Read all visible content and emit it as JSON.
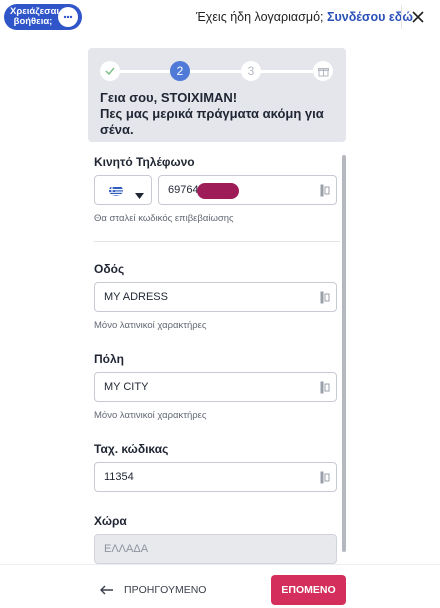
{
  "header": {
    "help_label": "Χρειάζεσαι βοήθεια;",
    "have_account_text": "Έχεις ήδη λογαριασμό;",
    "login_link": "Συνδέσου εδώ",
    "help_icon": "chat-bubble-icon",
    "close_icon": "close-icon"
  },
  "stepper": {
    "steps": [
      {
        "label": "",
        "icon": "check-icon",
        "state": "completed"
      },
      {
        "label": "2",
        "state": "active"
      },
      {
        "label": "3",
        "state": "upcoming"
      },
      {
        "label": "",
        "icon": "gift-icon",
        "state": "upcoming"
      }
    ],
    "greeting_line1": "Γεια σου, STOIXIMAN!",
    "greeting_line2": "Πες μας μερικά πράγματα ακόμη για σένα."
  },
  "form": {
    "phone": {
      "label": "Κινητό Τηλέφωνο",
      "country_flag": "greece-flag-icon",
      "value": "69764",
      "hint": "Θα σταλεί κωδικός επιβεβαίωσης"
    },
    "street": {
      "label": "Οδός",
      "value": "MY ADRESS",
      "hint": "Μόνο λατινικοί χαρακτήρες"
    },
    "city": {
      "label": "Πόλη",
      "value": "MY CITY",
      "hint": "Μόνο λατινικοί χαρακτήρες"
    },
    "postal": {
      "label": "Ταχ. κώδικας",
      "value": "11354"
    },
    "country": {
      "label": "Χώρα",
      "value": "ΕΛΛΑΔΑ"
    }
  },
  "footer": {
    "prev_label": "ΠΡΟΗΓΟΥΜΕΝΟ",
    "next_label": "ΕΠΟΜΕΝΟ"
  },
  "colors": {
    "brand_blue": "#2f55c9",
    "step_active": "#4f7ad8",
    "next_button": "#d42f5c",
    "link": "#2b50b8"
  }
}
